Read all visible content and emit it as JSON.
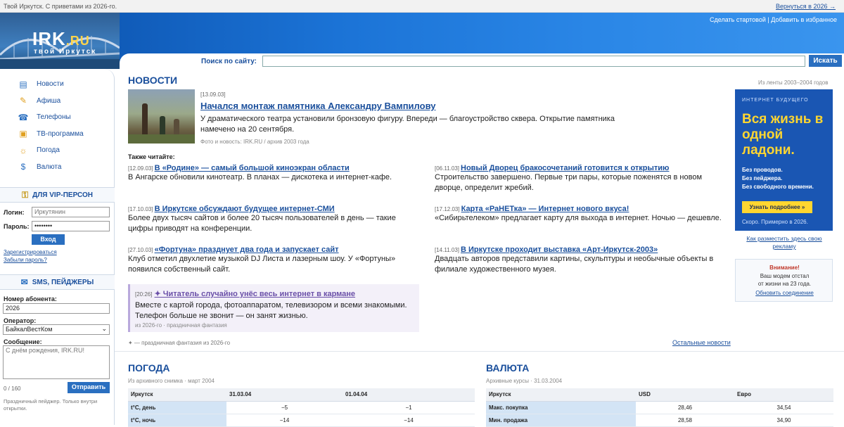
{
  "topbar": {
    "left": "Твой Иркутск. С приветами из 2026-го.",
    "right": "Вернуться в 2026 →"
  },
  "header": {
    "logo_main": "IRK",
    "logo_tld": ".RU",
    "logo_sub": "твой Иркутск",
    "link_start": "Сделать стартовой",
    "link_sep": "|",
    "link_fav": "Добавить в избранное"
  },
  "search": {
    "label": "Поиск по сайту:",
    "placeholder": "",
    "button": "Искать"
  },
  "sidebar": {
    "nav": [
      {
        "label": "Новости",
        "icon": "newspaper-icon"
      },
      {
        "label": "Афиша",
        "icon": "poster-icon"
      },
      {
        "label": "Телефоны",
        "icon": "phone-icon"
      },
      {
        "label": "ТВ-программа",
        "icon": "tv-icon"
      },
      {
        "label": "Погода",
        "icon": "weather-icon"
      },
      {
        "label": "Валюта",
        "icon": "currency-icon"
      }
    ],
    "vip": {
      "title": "ДЛЯ VIP-ПЕРСОН",
      "login_label": "Логин:",
      "login_value": "Иркутянин",
      "password_label": "Пароль:",
      "password_value": "••••••••",
      "submit": "Вход",
      "register": "Зарегистрироваться",
      "forgot": "Забыли пароль?"
    },
    "sms": {
      "title": "SMS, ПЕЙДЖЕРЫ",
      "number_label": "Номер абонента:",
      "number_value": "2026",
      "operator_label": "Оператор:",
      "operator_value": "БайкалВестКом",
      "message_label": "Сообщение:",
      "message_value": "С днём рождения, IRK.RU!",
      "counter": "0 / 160",
      "send": "Отправить",
      "note": "Праздничный пейджер. Только внутри открытки."
    }
  },
  "news": {
    "title": "НОВОСТИ",
    "source_note": "Из ленты 2003–2004 годов",
    "lead": {
      "date": "[13.09.03]",
      "headline": "Начался монтаж памятника Александру Вампилову",
      "body": "У драматического театра установили бронзовую фигуру. Впереди — благоустройство сквера. Открытие памятника намечено на 20 сентября.",
      "caption": "Фото и новость: IRK.RU / архив 2003 года"
    },
    "also_read": "Также читайте:",
    "items": [
      {
        "date": "[12.09.03]",
        "headline": "В «Родине» — самый большой киноэкран области",
        "body": "В Ангарске обновили кинотеатр. В планах — дискотека и интернет-кафе."
      },
      {
        "date": "[06.11.03]",
        "headline": "Новый Дворец бракосочетаний готовится к открытию",
        "body": "Строительство завершено. Первые три пары, которые поженятся в новом дворце, определит жребий."
      },
      {
        "date": "[17.10.03]",
        "headline": "В Иркутске обсуждают будущее интернет-СМИ",
        "body": "Более двух тысяч сайтов и более 20 тысяч пользователей в день — такие цифры приводят на конференции."
      },
      {
        "date": "[17.12.03]",
        "headline": "Карта «РаНЕТка» — Интернет нового вкуса!",
        "body": "«Сибирьтелеком» предлагает карту для выхода в интернет. Ночью — дешевле."
      },
      {
        "date": "[27.10.03]",
        "headline": "«Фортуна» празднует два года и запускает сайт",
        "body": "Клуб отметил двухлетие музыкой DJ Листа и лазерным шоу. У «Фортуны» появился собственный сайт."
      },
      {
        "date": "[14.11.03]",
        "headline": "В Иркутске проходит выставка «Арт-Иркутск-2003»",
        "body": "Двадцать авторов представили картины, скульптуры и необычные объекты в филиале художественного музея."
      }
    ],
    "fantasy": {
      "date": "[20:26]",
      "headline": "✦ Читатель случайно унёс весь интернет в кармане",
      "body": "Вместе с картой города, фотоаппаратом, телевизором и всеми знакомыми. Телефон больше не звонит — он занят жизнью.",
      "caption": "из 2026-го · праздничная фантазия"
    },
    "footnote": "✦ — праздничная фантазия из 2026-го",
    "other_link": "Остальные новости"
  },
  "ad": {
    "kicker": "ИНТЕРНЕТ БУДУЩЕГО",
    "headline": "Вся жизнь в одной ладони.",
    "lines": [
      "Без проводов.",
      "Без пейджера.",
      "Без свободного времени."
    ],
    "button": "Узнать подробнее »",
    "small": "Скоро. Примерно в 2026.",
    "place_ad": "Как разместить здесь свою рекламу"
  },
  "warning": {
    "title": "Внимание!",
    "line1": "Ваш модем отстал",
    "line2": "от жизни на 23 года.",
    "link": "Обновить соединение"
  },
  "weather": {
    "title": "ПОГОДА",
    "note": "Из архивного снимка · март 2004",
    "headers": [
      "Иркутск",
      "31.03.04",
      "01.04.04"
    ],
    "rows": [
      [
        "t°C, день",
        "−5",
        "−1"
      ],
      [
        "t°C, ночь",
        "−14",
        "−14"
      ]
    ]
  },
  "currency": {
    "title": "ВАЛЮТА",
    "note": "Архивные курсы · 31.03.2004",
    "headers": [
      "Иркутск",
      "USD",
      "Евро"
    ],
    "rows": [
      [
        "Макс. покупка",
        "28,46",
        "34,54"
      ],
      [
        "Мин. продажа",
        "28,58",
        "34,90"
      ]
    ]
  },
  "colors": {
    "brand_blue": "#1a4f9c",
    "header_blue": "#1b73d6",
    "ad_yellow": "#ffd630",
    "fantasy_bg": "#f3f0f9"
  }
}
